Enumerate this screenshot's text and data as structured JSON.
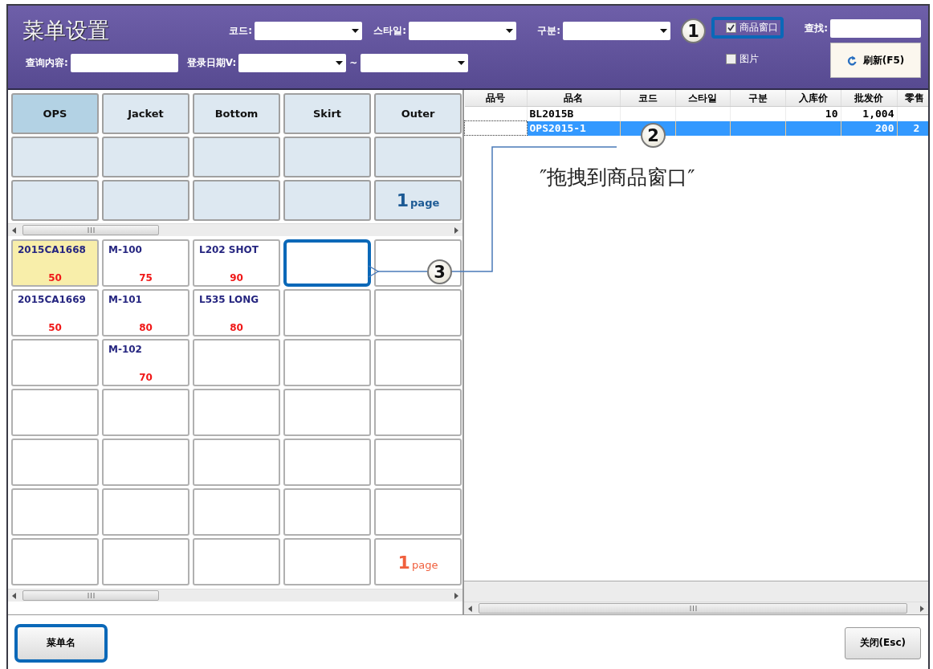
{
  "window": {
    "title": "菜单设置"
  },
  "filters": [
    {
      "label": "코드:",
      "kind": "dropdown"
    },
    {
      "label": "스타일:",
      "kind": "dropdown"
    },
    {
      "label": "구분:",
      "kind": "dropdown"
    }
  ],
  "query": {
    "label": "查询内容:"
  },
  "date_range": {
    "label": "登录日期V:",
    "separator": "~"
  },
  "checkboxes": [
    {
      "label": "商品窗口",
      "checked": true,
      "highlighted": true
    },
    {
      "label": "图片",
      "checked": false,
      "highlighted": false
    }
  ],
  "search": {
    "label": "查找:"
  },
  "refresh_button": {
    "label": "刷新(F5)"
  },
  "categories": [
    [
      {
        "kind": "category",
        "label": "OPS",
        "selected": true
      },
      {
        "kind": "category",
        "label": "Jacket",
        "selected": false
      },
      {
        "kind": "category",
        "label": "Bottom",
        "selected": false
      },
      {
        "kind": "category",
        "label": "Skirt",
        "selected": false
      },
      {
        "kind": "category",
        "label": "Outer",
        "selected": false
      }
    ],
    [
      {
        "kind": "empty"
      },
      {
        "kind": "empty"
      },
      {
        "kind": "empty"
      },
      {
        "kind": "empty"
      },
      {
        "kind": "empty"
      }
    ],
    [
      {
        "kind": "empty"
      },
      {
        "kind": "empty"
      },
      {
        "kind": "empty"
      },
      {
        "kind": "empty"
      },
      {
        "kind": "page",
        "number": "1",
        "unit": "page"
      }
    ]
  ],
  "products": [
    [
      {
        "kind": "item",
        "name": "2015CA1668",
        "qty": "50",
        "selected": true
      },
      {
        "kind": "item",
        "name": "M-100",
        "qty": "75",
        "selected": false
      },
      {
        "kind": "item",
        "name": "L202 SHOT",
        "qty": "90",
        "selected": false
      },
      {
        "kind": "empty",
        "highlighted": true
      },
      {
        "kind": "empty",
        "highlighted": false
      }
    ],
    [
      {
        "kind": "item",
        "name": "2015CA1669",
        "qty": "50",
        "selected": false
      },
      {
        "kind": "item",
        "name": "M-101",
        "qty": "80",
        "selected": false
      },
      {
        "kind": "item",
        "name": "L535 LONG",
        "qty": "80",
        "selected": false
      },
      {
        "kind": "empty",
        "highlighted": false
      },
      {
        "kind": "empty",
        "highlighted": false
      }
    ],
    [
      {
        "kind": "empty",
        "highlighted": false
      },
      {
        "kind": "item",
        "name": "M-102",
        "qty": "70",
        "selected": false
      },
      {
        "kind": "empty",
        "highlighted": false
      },
      {
        "kind": "empty",
        "highlighted": false
      },
      {
        "kind": "empty",
        "highlighted": false
      }
    ],
    [
      {
        "kind": "empty",
        "highlighted": false
      },
      {
        "kind": "empty",
        "highlighted": false
      },
      {
        "kind": "empty",
        "highlighted": false
      },
      {
        "kind": "empty",
        "highlighted": false
      },
      {
        "kind": "empty",
        "highlighted": false
      }
    ],
    [
      {
        "kind": "empty",
        "highlighted": false
      },
      {
        "kind": "empty",
        "highlighted": false
      },
      {
        "kind": "empty",
        "highlighted": false
      },
      {
        "kind": "empty",
        "highlighted": false
      },
      {
        "kind": "empty",
        "highlighted": false
      }
    ],
    [
      {
        "kind": "empty",
        "highlighted": false
      },
      {
        "kind": "empty",
        "highlighted": false
      },
      {
        "kind": "empty",
        "highlighted": false
      },
      {
        "kind": "empty",
        "highlighted": false
      },
      {
        "kind": "empty",
        "highlighted": false
      }
    ],
    [
      {
        "kind": "empty",
        "highlighted": false
      },
      {
        "kind": "empty",
        "highlighted": false
      },
      {
        "kind": "empty",
        "highlighted": false
      },
      {
        "kind": "empty",
        "highlighted": false
      },
      {
        "kind": "page",
        "number": "1",
        "unit": "page"
      }
    ]
  ],
  "table": {
    "columns": [
      "品号",
      "品名",
      "코드",
      "스타일",
      "구분",
      "入库价",
      "批发价",
      "零售"
    ],
    "rows": [
      {
        "selected": false,
        "cells": [
          "",
          "BL2015B",
          "",
          "",
          "",
          "10",
          "1,004",
          ""
        ]
      },
      {
        "selected": true,
        "cells": [
          "",
          "OPS2015-1",
          "",
          "",
          "",
          "",
          "200",
          "2"
        ]
      }
    ]
  },
  "annotations": {
    "markers": [
      "1",
      "2",
      "3"
    ],
    "caption": "″拖拽到商品窗口″"
  },
  "menu_name_button": {
    "label": "菜单名",
    "highlighted": true
  },
  "close_button": {
    "label": "关闭(Esc)"
  }
}
